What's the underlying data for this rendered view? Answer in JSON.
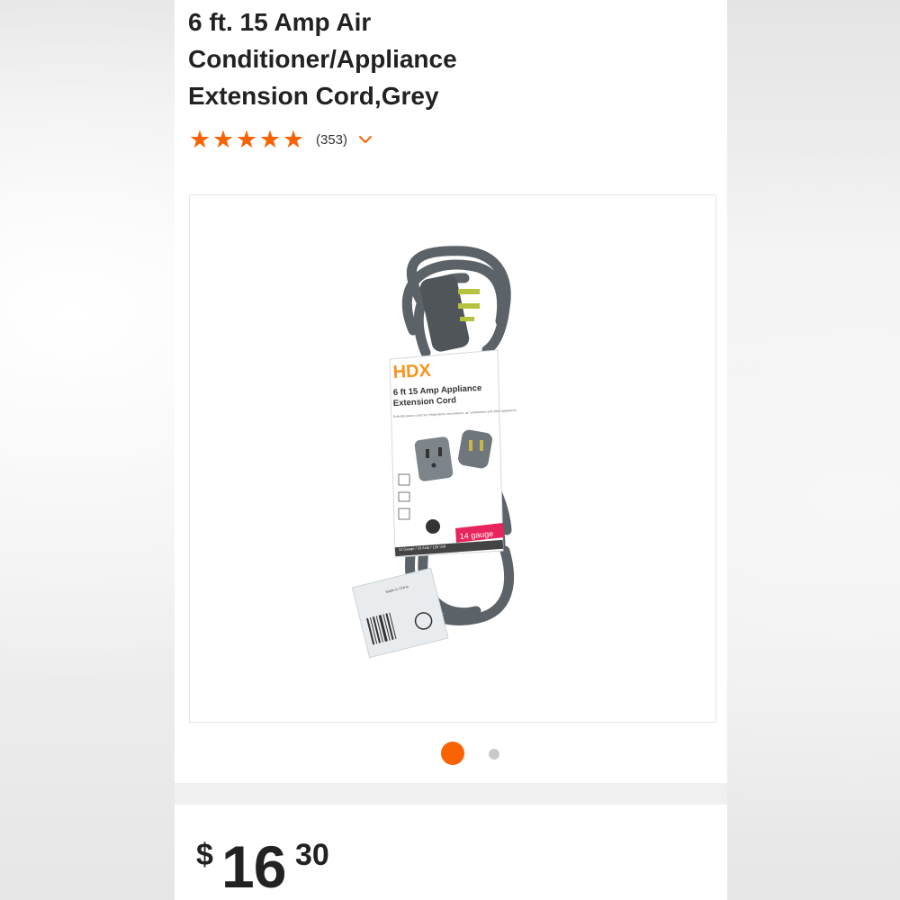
{
  "product": {
    "title": "6 ft. 15 Amp Air Conditioner/Appliance Extension Cord,Grey",
    "rating": 5,
    "rating_max": 5,
    "review_count": "(353)"
  },
  "gallery": {
    "image_count": 2,
    "active_index": 0,
    "image": {
      "package_brand": "HDX",
      "package_title_line1": "6 ft 15 Amp Appliance",
      "package_title_line2": "Extension Cord",
      "package_badge": "14 gauge",
      "package_description": "Extends power cords for refrigerators, microwaves, air conditioners and other appliances",
      "package_spec": "14 Gauge / 15 Amp / 125 Volt",
      "tag_text": "Made in China"
    }
  },
  "price": {
    "currency": "$",
    "dollars": "16",
    "cents": "30"
  },
  "colors": {
    "accent": "#f96302",
    "title_text": "#222222",
    "dot_inactive": "#c9c9c9"
  },
  "icons": {
    "star": "star-icon",
    "chevron": "chevron-down-icon"
  }
}
